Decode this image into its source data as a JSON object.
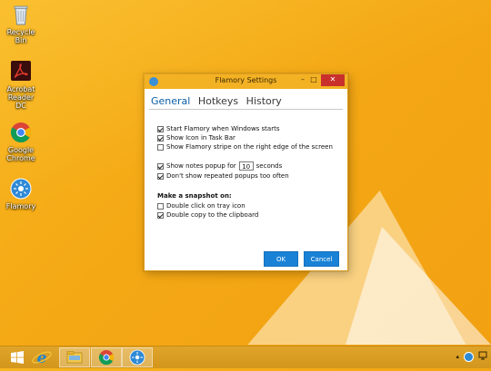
{
  "desktop": {
    "icons": [
      {
        "label": "Recycle Bin",
        "icon": "recycle-bin-icon"
      },
      {
        "label": "Acrobat Reader DC",
        "icon": "acrobat-icon"
      },
      {
        "label": "Google Chrome",
        "icon": "chrome-icon"
      },
      {
        "label": "Flamory",
        "icon": "flamory-icon"
      }
    ]
  },
  "dialog": {
    "title": "Flamory Settings",
    "tabs": [
      "General",
      "Hotkeys",
      "History"
    ],
    "options": {
      "start_with_windows": "Start Flamory when Windows starts",
      "show_icon_taskbar": "Show Icon in Task Bar",
      "show_stripe": "Show Flamory stripe on the right edge of the screen",
      "show_popup_for": "Show notes popup for",
      "popup_seconds_value": "10",
      "seconds_label": "seconds",
      "dont_repeat": "Don't show repeated popups too often"
    },
    "snapshot_section": "Make a snapshot on:",
    "snapshot_options": {
      "double_click_tray": "Double click on tray icon",
      "double_copy": "Double copy to the clipboard"
    },
    "ok_label": "OK",
    "cancel_label": "Cancel"
  },
  "colors": {
    "accent": "#1a82d6",
    "titlebar": "#f3b124",
    "close": "#c9302c"
  },
  "taskbar": {
    "items": [
      "windows-start-icon",
      "internet-explorer-icon",
      "file-explorer-icon",
      "chrome-icon",
      "flamory-icon"
    ],
    "tray": [
      "chevron-up-icon",
      "flamory-tray-icon",
      "network-icon"
    ]
  }
}
